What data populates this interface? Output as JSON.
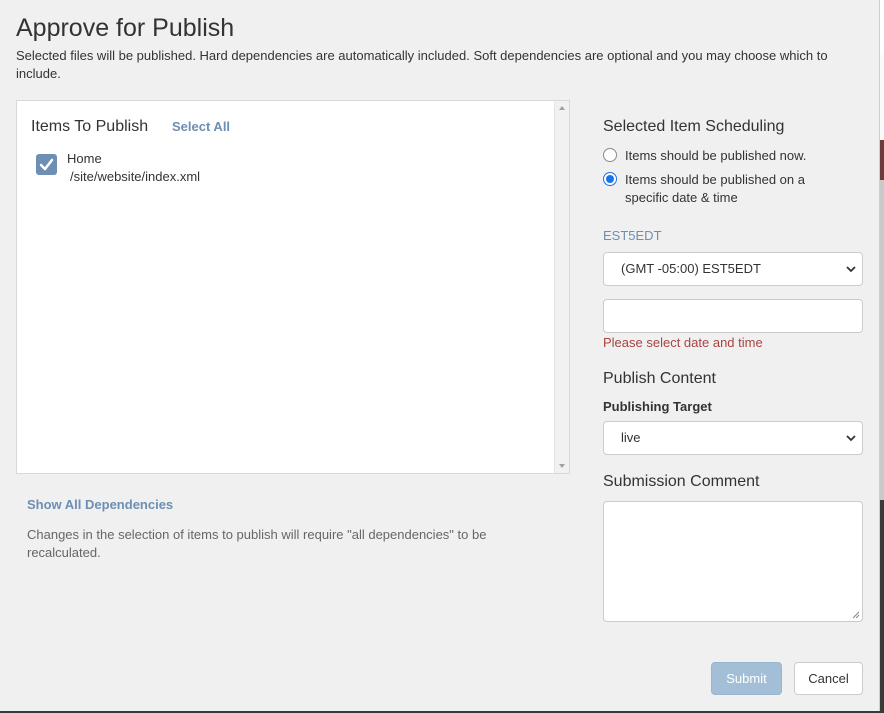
{
  "dialog": {
    "title": "Approve for Publish",
    "description": "Selected files will be published. Hard dependencies are automatically included. Soft dependencies are optional and you may choose which to include."
  },
  "items_panel": {
    "header": "Items To Publish",
    "select_all_label": "Select All",
    "items": [
      {
        "name": "Home",
        "path": "/site/website/index.xml",
        "checked": true
      }
    ]
  },
  "dependencies": {
    "show_all_label": "Show All Dependencies",
    "note": "Changes in the selection of items to publish will require \"all dependencies\" to be recalculated."
  },
  "scheduling": {
    "title": "Selected Item Scheduling",
    "option_now": "Items should be published now.",
    "option_specific": "Items should be published on a specific date & time",
    "selected_option": "specific",
    "timezone_label": "EST5EDT",
    "timezone_value": "(GMT -05:00) EST5EDT",
    "datetime_value": "",
    "error_text": "Please select date and time"
  },
  "publish_content": {
    "title": "Publish Content",
    "target_label": "Publishing Target",
    "target_value": "live"
  },
  "submission": {
    "title": "Submission Comment",
    "comment_value": ""
  },
  "buttons": {
    "submit_label": "Submit",
    "cancel_label": "Cancel"
  },
  "colors": {
    "accent": "#6d8fb3",
    "error": "#a94442",
    "submit_disabled": "#a3bfd7",
    "radio_selected": "#1a73e8"
  }
}
